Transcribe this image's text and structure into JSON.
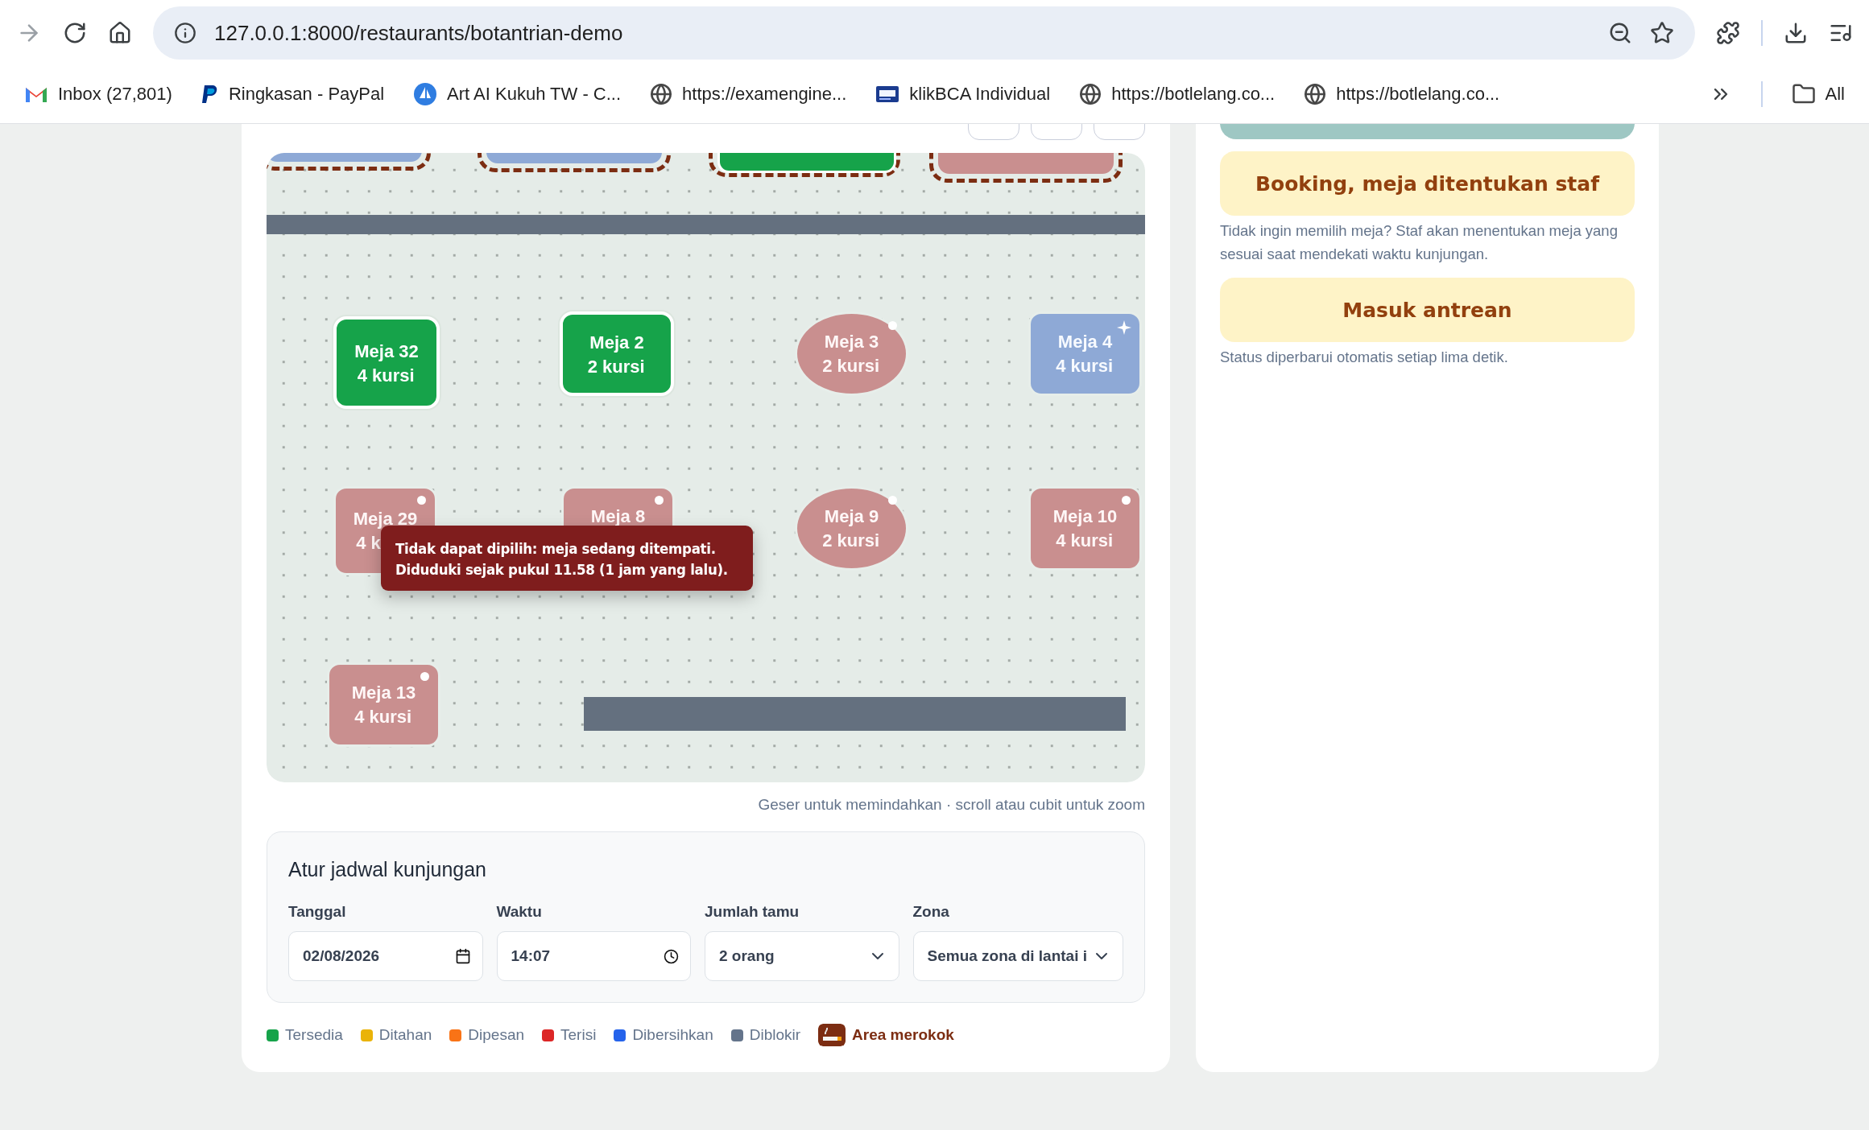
{
  "browser": {
    "url": "127.0.0.1:8000/restaurants/botantrian-demo",
    "bookmarks": [
      {
        "label": "Inbox (27,801)",
        "kind": "mail"
      },
      {
        "label": "Ringkasan - PayPal",
        "kind": "pay"
      },
      {
        "label": "Art AI Kukuh TW - C...",
        "kind": "boat"
      },
      {
        "label": "https://examengine...",
        "kind": "globe"
      },
      {
        "label": "klikBCA Individual",
        "kind": "bank"
      },
      {
        "label": "https://botlelang.co...",
        "kind": "globe"
      },
      {
        "label": "https://botlelang.co...",
        "kind": "globe"
      }
    ],
    "folder_label": "All"
  },
  "floor_map": {
    "top_tables": [
      {
        "kind": "cleaning",
        "smoking": true
      },
      {
        "kind": "cleaning",
        "smoking": true
      },
      {
        "kind": "available",
        "smoking": true
      },
      {
        "kind": "occupied",
        "smoking": true
      }
    ],
    "tables": [
      {
        "name": "Meja 32",
        "seats": "4 kursi",
        "kind": "available",
        "round": false,
        "smoking": false
      },
      {
        "name": "Meja 2",
        "seats": "2 kursi",
        "kind": "available",
        "round": false,
        "smoking": false
      },
      {
        "name": "Meja 3",
        "seats": "2 kursi",
        "kind": "occupied",
        "round": true,
        "smoking": false
      },
      {
        "name": "Meja 4",
        "seats": "4 kursi",
        "kind": "cleaning",
        "round": false,
        "smoking": false
      },
      {
        "name": "Meja 29",
        "seats": "4 k",
        "kind": "occupied",
        "round": false,
        "smoking": false
      },
      {
        "name": "Meja 8",
        "kind": "occupied",
        "round": false,
        "smoking": false
      },
      {
        "name": "Meja 9",
        "seats": "2 kursi",
        "kind": "occupied",
        "round": true,
        "smoking": false
      },
      {
        "name": "Meja 10",
        "seats": "4 kursi",
        "kind": "occupied",
        "round": false,
        "smoking": false
      },
      {
        "name": "Meja 13",
        "seats": "4 kursi",
        "kind": "occupied",
        "round": false,
        "smoking": false
      }
    ],
    "tooltip": {
      "lines": [
        "Tidak dapat dipilih: meja sedang ditempati.",
        "Diduduki sejak pukul 11.58 (1 jam yang lalu)."
      ]
    },
    "hint": "Geser untuk memindahkan · scroll atau cubit untuk zoom"
  },
  "schedule": {
    "title": "Atur jadwal kunjungan",
    "fields": [
      {
        "label": "Tanggal",
        "value": "02/08/2026",
        "kind": "date"
      },
      {
        "label": "Waktu",
        "value": "14:07",
        "kind": "time"
      },
      {
        "label": "Jumlah tamu",
        "value": "2 orang",
        "kind": "select"
      },
      {
        "label": "Zona",
        "value": "Semua zona di lantai i",
        "kind": "select"
      }
    ]
  },
  "legend": [
    {
      "label": "Tersedia",
      "color": "#16a34a",
      "kind": "dot"
    },
    {
      "label": "Ditahan",
      "color": "#eab308",
      "kind": "dot"
    },
    {
      "label": "Dipesan",
      "color": "#f97316",
      "kind": "dot"
    },
    {
      "label": "Terisi",
      "color": "#dc2626",
      "kind": "dot"
    },
    {
      "label": "Dibersihkan",
      "color": "#2563eb",
      "kind": "dot"
    },
    {
      "label": "Diblokir",
      "color": "#64748b",
      "kind": "dot"
    },
    {
      "label": "Area merokok",
      "kind": "smoking"
    }
  ],
  "side": {
    "actions": [
      {
        "label": "Booking, meja ditentukan staf",
        "note": "Tidak ingin memilih meja? Staf akan menentukan meja yang sesuai saat mendekati waktu kunjungan."
      },
      {
        "label": "Masuk antrean",
        "note": "Status diperbarui otomatis setiap lima detik."
      }
    ]
  }
}
